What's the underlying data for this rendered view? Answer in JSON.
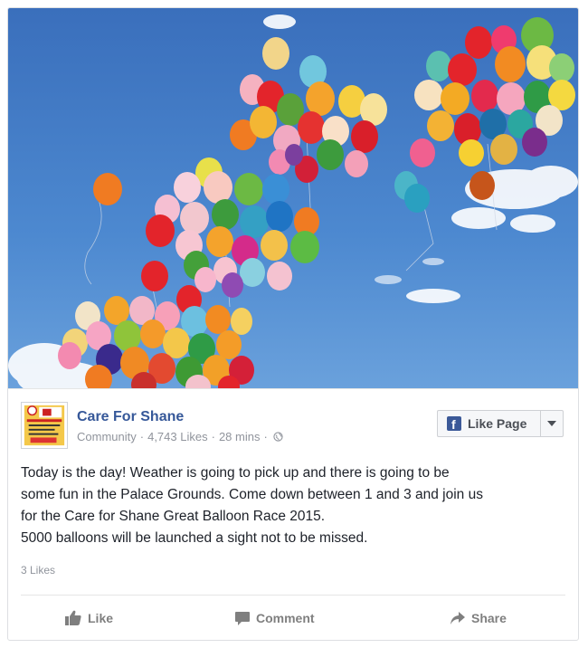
{
  "post": {
    "page_name": "Care For Shane",
    "category": "Community",
    "likes_count": "4,743 Likes",
    "time": "28 mins",
    "separator": "·",
    "like_page_label": "Like Page",
    "text_lines": [
      "Today is the day! Weather is going to pick up and there is going to be",
      "some fun in the Palace Grounds. Come down between 1 and 3 and join us",
      "for the Care for Shane Great Balloon Race 2015.",
      "5000 balloons will be launched a sight not to be missed."
    ],
    "reactions": "3 Likes"
  },
  "actions": {
    "like": "Like",
    "comment": "Comment",
    "share": "Share"
  },
  "icons": {
    "avatar": "page-logo-avatar",
    "globe": "globe-icon",
    "fb": "facebook-f-icon",
    "like": "thumbs-up-icon",
    "comment": "comment-bubble-icon",
    "share": "share-arrow-icon",
    "dropdown": "chevron-down-icon"
  },
  "colors": {
    "link": "#365899",
    "fb_blue": "#3b5998",
    "sky": "#3f78c4",
    "muted": "#90949c",
    "text": "#1d2129"
  }
}
